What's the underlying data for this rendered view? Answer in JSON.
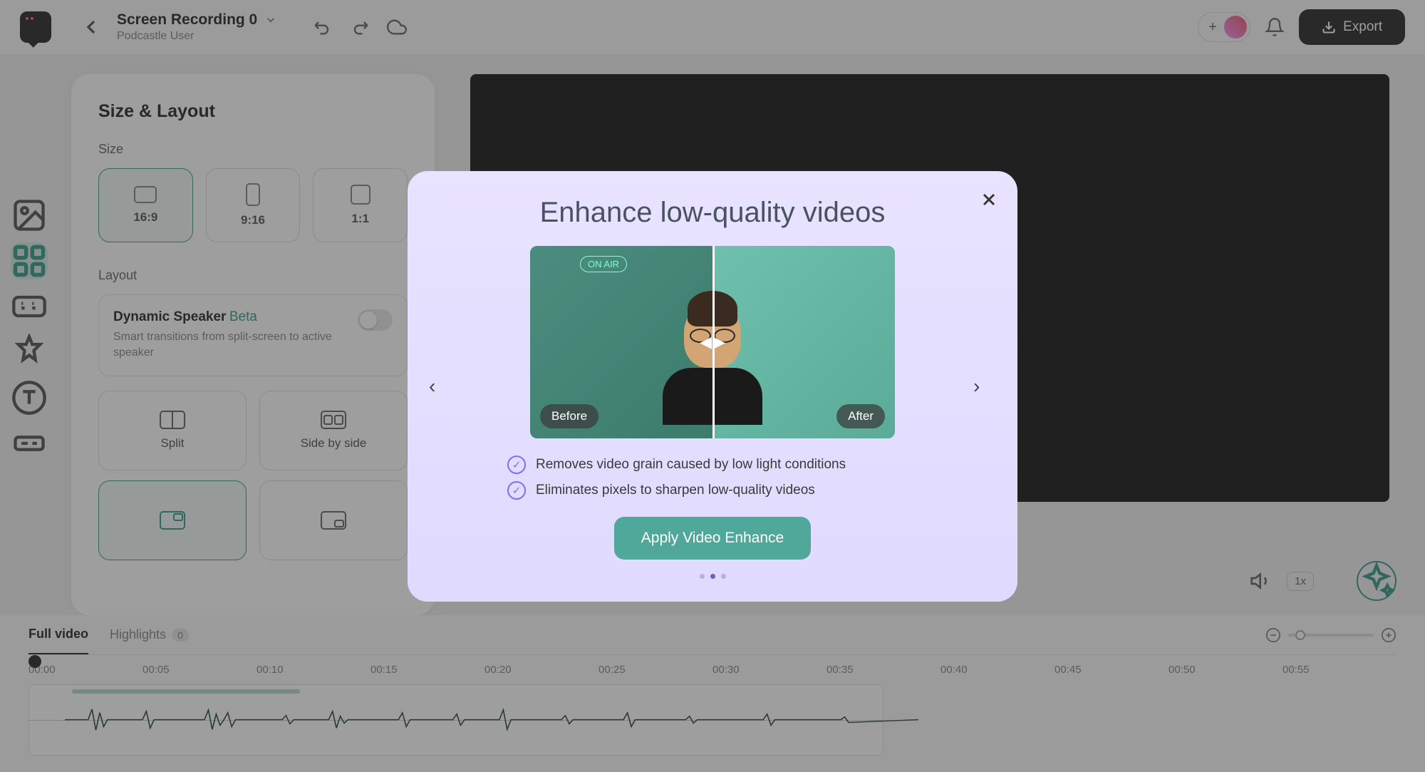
{
  "header": {
    "title": "Screen Recording 0",
    "subtitle": "Podcastle User",
    "export_label": "Export"
  },
  "panel": {
    "title": "Size & Layout",
    "size_label": "Size",
    "layout_label": "Layout",
    "sizes": [
      {
        "label": "16:9",
        "selected": true
      },
      {
        "label": "9:16",
        "selected": false
      },
      {
        "label": "1:1",
        "selected": false
      }
    ],
    "dynamic": {
      "title": "Dynamic Speaker",
      "beta": "Beta",
      "desc": "Smart transitions from split-screen to active speaker",
      "enabled": false
    },
    "layouts": [
      {
        "label": "Split"
      },
      {
        "label": "Side by side"
      }
    ]
  },
  "preview": {
    "speed": "1x"
  },
  "tabs": {
    "full": "Full video",
    "highlights": "Highlights",
    "highlight_count": "0"
  },
  "timeline": {
    "ticks": [
      "00:00",
      "00:05",
      "00:10",
      "00:15",
      "00:20",
      "00:25",
      "00:30",
      "00:35",
      "00:40",
      "00:45",
      "00:50",
      "00:55"
    ]
  },
  "modal": {
    "title": "Enhance low-quality videos",
    "before_label": "Before",
    "after_label": "After",
    "neon_text": "ON AIR",
    "bullets": [
      "Removes video grain caused by low light conditions",
      "Eliminates pixels to sharpen low-quality videos"
    ],
    "apply_label": "Apply Video Enhance",
    "active_dot": 1,
    "dot_count": 3
  }
}
